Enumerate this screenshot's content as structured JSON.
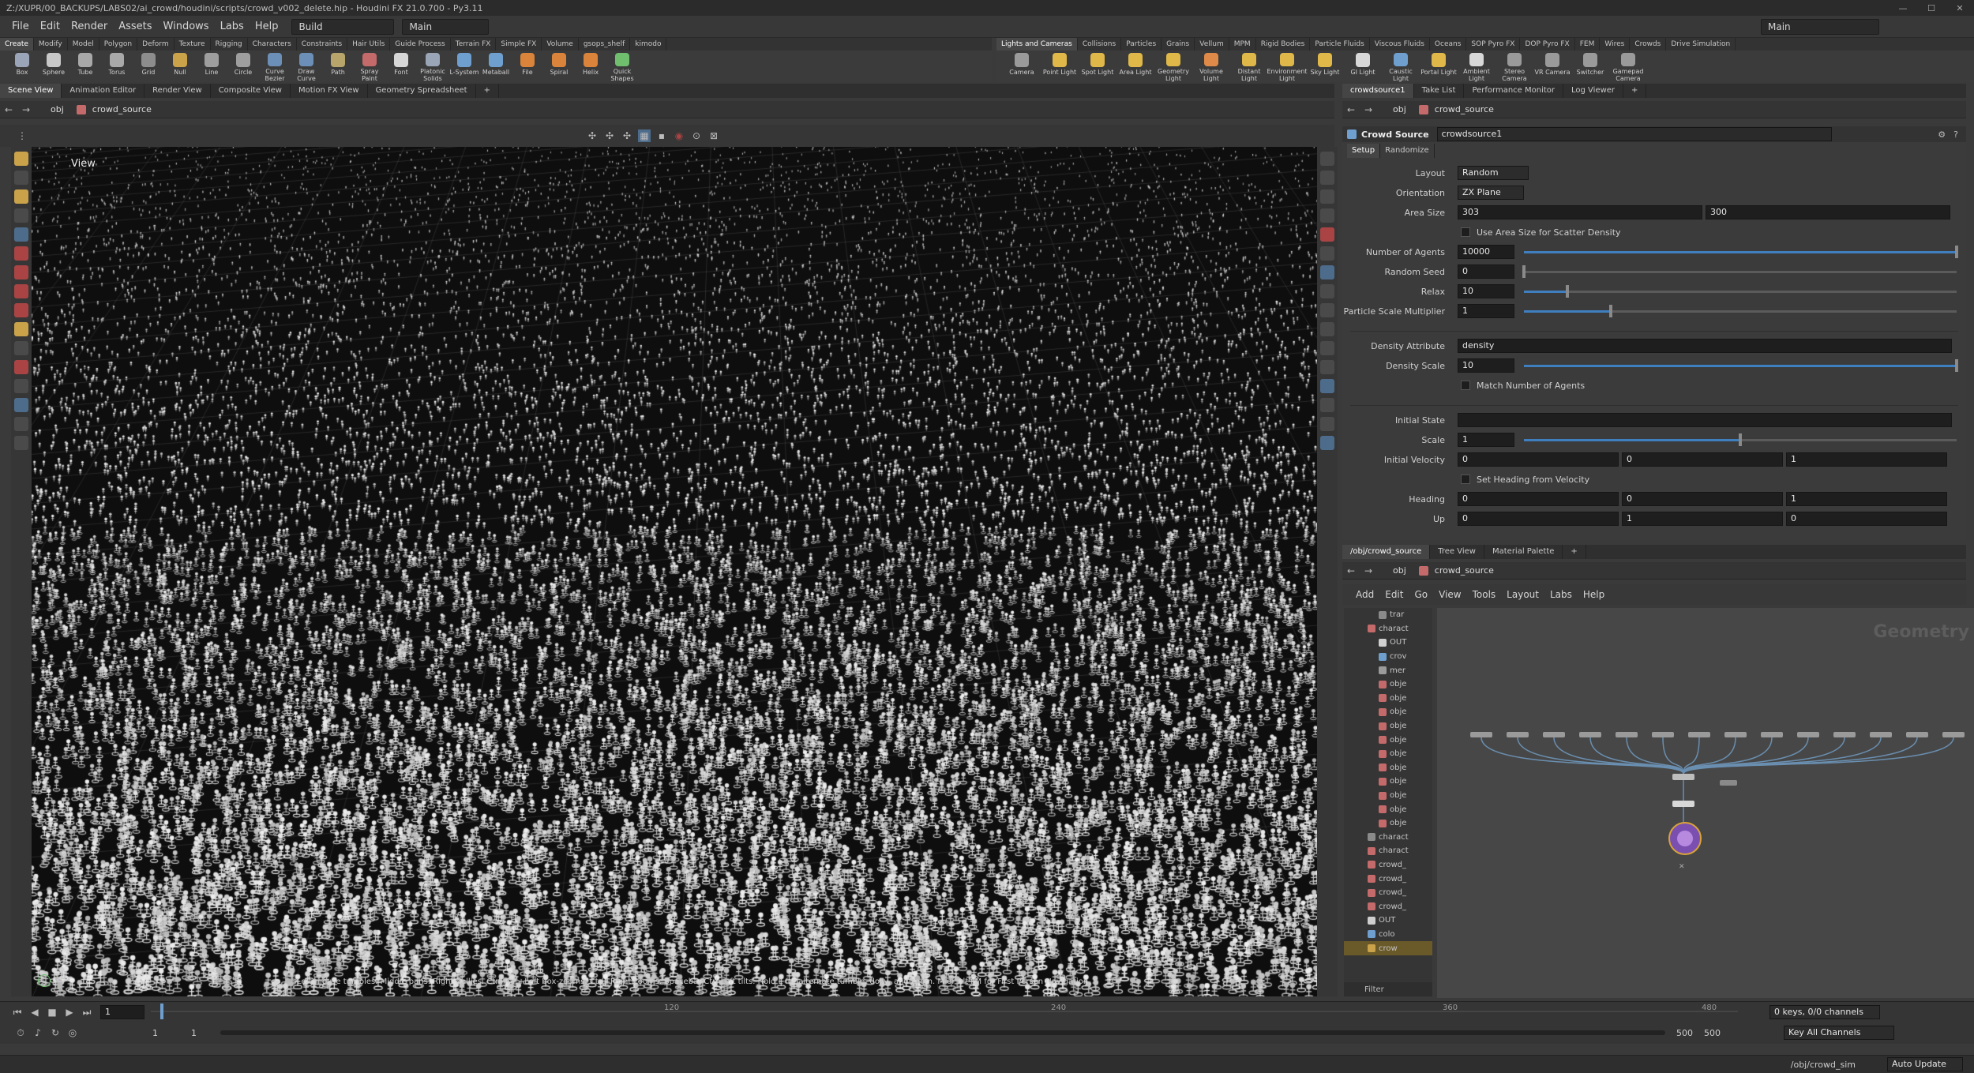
{
  "window": {
    "title": "Z:/XUPR/00_BACKUPS/LABS02/ai_crowd/houdini/scripts/crowd_v002_delete.hip - Houdini FX 21.0.700 - Py3.11"
  },
  "menubar": {
    "items": [
      "File",
      "Edit",
      "Render",
      "Assets",
      "Windows",
      "Labs",
      "Help"
    ],
    "build_label": "Build",
    "desktop_label": "Main",
    "right_desktop": "Main"
  },
  "shelf_tabs_left": [
    "Create",
    "Modify",
    "Model",
    "Polygon",
    "Deform",
    "Texture",
    "Rigging",
    "Characters",
    "Constraints",
    "Hair Utils",
    "Guide Process",
    "Terrain FX",
    "Simple FX",
    "Volume",
    "gsops_shelf",
    "kimodo"
  ],
  "shelf_tabs_right": [
    "Lights and Cameras",
    "Collisions",
    "Particles",
    "Grains",
    "Vellum",
    "MPM",
    "Rigid Bodies",
    "Particle Fluids",
    "Viscous Fluids",
    "Oceans",
    "SOP Pyro FX",
    "DOP Pyro FX",
    "FEM",
    "Wires",
    "Crowds",
    "Drive Simulation"
  ],
  "tools_left": [
    {
      "label": "Box",
      "icon": "box-icon",
      "color": "#9aa6b8"
    },
    {
      "label": "Sphere",
      "icon": "sphere-icon",
      "color": "#c8c8c8"
    },
    {
      "label": "Tube",
      "icon": "tube-icon",
      "color": "#a9a9a9"
    },
    {
      "label": "Torus",
      "icon": "torus-icon",
      "color": "#a9a9a9"
    },
    {
      "label": "Grid",
      "icon": "grid-icon",
      "color": "#8d8d8d"
    },
    {
      "label": "Null",
      "icon": "null-icon",
      "color": "#c9a24a"
    },
    {
      "label": "Line",
      "icon": "line-icon",
      "color": "#9e9e9e"
    },
    {
      "label": "Circle",
      "icon": "circle-icon",
      "color": "#9e9e9e"
    },
    {
      "label": "Curve Bezier",
      "icon": "curve-bezier-icon",
      "color": "#6c8fb8"
    },
    {
      "label": "Draw Curve",
      "icon": "draw-curve-icon",
      "color": "#6c8fb8"
    },
    {
      "label": "Path",
      "icon": "path-icon",
      "color": "#b8a56c"
    },
    {
      "label": "Spray Paint",
      "icon": "spray-paint-icon",
      "color": "#c46a6a"
    },
    {
      "label": "Font",
      "icon": "font-icon",
      "color": "#d6d6d6"
    },
    {
      "label": "Platonic Solids",
      "icon": "platonic-icon",
      "color": "#9aa6b8"
    },
    {
      "label": "L-System",
      "icon": "lsystem-icon",
      "color": "#6f9fcf"
    },
    {
      "label": "Metaball",
      "icon": "metaball-icon",
      "color": "#6f9fcf"
    },
    {
      "label": "File",
      "icon": "file-icon",
      "color": "#d9843a"
    },
    {
      "label": "Spiral",
      "icon": "spiral-icon",
      "color": "#d9843a"
    },
    {
      "label": "Helix",
      "icon": "helix-icon",
      "color": "#d9843a"
    },
    {
      "label": "Quick Shapes",
      "icon": "quick-shapes-icon",
      "color": "#6fbf6f"
    }
  ],
  "tools_right": [
    {
      "label": "Camera",
      "icon": "camera-icon",
      "color": "#9a9a9a"
    },
    {
      "label": "Point Light",
      "icon": "point-light-icon",
      "color": "#e0b84a"
    },
    {
      "label": "Spot Light",
      "icon": "spot-light-icon",
      "color": "#e0b84a"
    },
    {
      "label": "Area Light",
      "icon": "area-light-icon",
      "color": "#e0b84a"
    },
    {
      "label": "Geometry Light",
      "icon": "geometry-light-icon",
      "color": "#e0b84a"
    },
    {
      "label": "Volume Light",
      "icon": "volume-light-icon",
      "color": "#e08a4a"
    },
    {
      "label": "Distant Light",
      "icon": "distant-light-icon",
      "color": "#e0b84a"
    },
    {
      "label": "Environment Light",
      "icon": "environment-light-icon",
      "color": "#e0b84a"
    },
    {
      "label": "Sky Light",
      "icon": "sky-light-icon",
      "color": "#e0b84a"
    },
    {
      "label": "GI Light",
      "icon": "gi-light-icon",
      "color": "#d8d8d8"
    },
    {
      "label": "Caustic Light",
      "icon": "caustic-light-icon",
      "color": "#6f9fcf"
    },
    {
      "label": "Portal Light",
      "icon": "portal-light-icon",
      "color": "#e0b84a"
    },
    {
      "label": "Ambient Light",
      "icon": "ambient-light-icon",
      "color": "#d8d8d8"
    },
    {
      "label": "Stereo Camera",
      "icon": "stereo-camera-icon",
      "color": "#9a9a9a"
    },
    {
      "label": "VR Camera",
      "icon": "vr-camera-icon",
      "color": "#9a9a9a"
    },
    {
      "label": "Switcher",
      "icon": "switcher-icon",
      "color": "#9a9a9a"
    },
    {
      "label": "Gamepad Camera",
      "icon": "gamepad-camera-icon",
      "color": "#9a9a9a"
    }
  ],
  "left_pane": {
    "tabs": [
      "Scene View",
      "Animation Editor",
      "Render View",
      "Composite View",
      "Motion FX View",
      "Geometry Spreadsheet"
    ],
    "path_obj": "obj",
    "path_node": "crowd_source",
    "viewport_label": "View",
    "hint": "Left mouse tumbles. Middle pans. Right dollies. Ctrl+Alt+Left box-zooms. Ctrl+Right zooms. Spacebar-Ctrl-Left tilts. Hold L for alternate tumble, dolly, and zoom. M or Alt+M for First Person Navigation."
  },
  "params_pane": {
    "tabs": [
      "crowdsource1",
      "Take List",
      "Performance Monitor",
      "Log Viewer"
    ],
    "path_obj": "obj",
    "path_node": "crowd_source",
    "node_type": "Crowd Source",
    "node_name": "crowdsource1",
    "subtabs": [
      "Setup",
      "Randomize"
    ],
    "layout": {
      "label": "Layout",
      "value": "Random"
    },
    "orientation": {
      "label": "Orientation",
      "value": "ZX Plane"
    },
    "area_size": {
      "label": "Area Size",
      "x": "303",
      "y": "300"
    },
    "use_area": {
      "label": "Use Area Size for Scatter Density"
    },
    "num_agents": {
      "label": "Number of Agents",
      "value": "10000",
      "level": 1.0
    },
    "random_seed": {
      "label": "Random Seed",
      "value": "0",
      "level": 0.0
    },
    "relax": {
      "label": "Relax",
      "value": "10",
      "level": 0.1
    },
    "particle_scale": {
      "label": "Particle Scale Multiplier",
      "value": "1",
      "level": 0.2
    },
    "density_attr": {
      "label": "Density Attribute",
      "value": "density"
    },
    "density_scale": {
      "label": "Density Scale",
      "value": "10",
      "level": 1.0
    },
    "match_agents": {
      "label": "Match Number of Agents"
    },
    "initial_state": {
      "label": "Initial State",
      "value": ""
    },
    "scale": {
      "label": "Scale",
      "value": "1",
      "level": 0.5
    },
    "initial_velocity": {
      "label": "Initial Velocity",
      "x": "0",
      "y": "0",
      "z": "1"
    },
    "set_heading": {
      "label": "Set Heading from Velocity"
    },
    "heading": {
      "label": "Heading",
      "x": "0",
      "y": "0",
      "z": "1"
    },
    "up": {
      "label": "Up",
      "x": "0",
      "y": "1",
      "z": "0"
    }
  },
  "network_pane": {
    "tabs": [
      "/obj/crowd_source",
      "Tree View",
      "Material Palette"
    ],
    "path_obj": "obj",
    "path_node": "crowd_source",
    "menu": [
      "Add",
      "Edit",
      "Go",
      "View",
      "Tools",
      "Layout",
      "Labs",
      "Help"
    ],
    "context_label": "Geometry",
    "tree_items": [
      {
        "label": "trar",
        "color": "#8a8a8a"
      },
      {
        "label": "charact",
        "color": "#c46a6a"
      },
      {
        "label": "OUT",
        "color": "#cfcfcf"
      },
      {
        "label": "crov",
        "color": "#6f9fcf"
      },
      {
        "label": "mer",
        "color": "#9a9a9a"
      },
      {
        "label": "obje",
        "color": "#c46a6a"
      },
      {
        "label": "obje",
        "color": "#c46a6a"
      },
      {
        "label": "obje",
        "color": "#c46a6a"
      },
      {
        "label": "obje",
        "color": "#c46a6a"
      },
      {
        "label": "obje",
        "color": "#c46a6a"
      },
      {
        "label": "obje",
        "color": "#c46a6a"
      },
      {
        "label": "obje",
        "color": "#c46a6a"
      },
      {
        "label": "obje",
        "color": "#c46a6a"
      },
      {
        "label": "obje",
        "color": "#c46a6a"
      },
      {
        "label": "obje",
        "color": "#c46a6a"
      },
      {
        "label": "obje",
        "color": "#c46a6a"
      },
      {
        "label": "charact",
        "color": "#8a8a8a"
      },
      {
        "label": "charact",
        "color": "#c46a6a"
      },
      {
        "label": "crowd_",
        "color": "#c46a6a"
      },
      {
        "label": "crowd_",
        "color": "#c46a6a"
      },
      {
        "label": "crowd_",
        "color": "#c46a6a"
      },
      {
        "label": "crowd_",
        "color": "#c46a6a"
      },
      {
        "label": "OUT",
        "color": "#cfcfcf"
      },
      {
        "label": "colo",
        "color": "#6f9fcf"
      },
      {
        "label": "crow",
        "color": "#c9a24a"
      }
    ],
    "filter_label": "Filter"
  },
  "timeline": {
    "current_frame": "1",
    "ticks": [
      "120",
      "240",
      "360",
      "480"
    ],
    "start": "1",
    "start2": "1",
    "end": "500",
    "end2": "500",
    "keys_label": "0 keys, 0/0 channels",
    "key_all": "Key All Channels"
  },
  "statusbar": {
    "path": "/obj/crowd_sim",
    "auto_update": "Auto Update"
  },
  "colors": {
    "accent": "#3f7fbf",
    "selection": "#d9a33a"
  }
}
